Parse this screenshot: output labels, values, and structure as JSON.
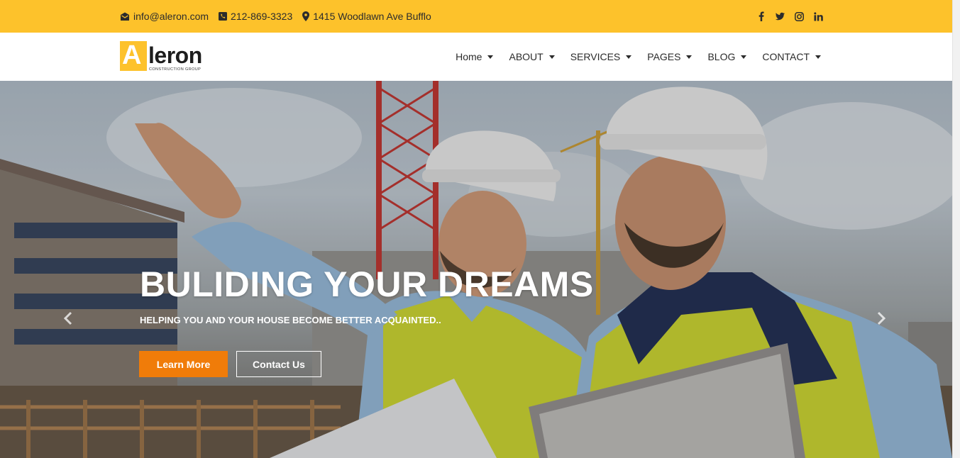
{
  "topbar": {
    "email": "info@aleron.com",
    "phone": "212-869-3323",
    "address": "1415 Woodlawn Ave Bufflo",
    "social": [
      "facebook-icon",
      "twitter-icon",
      "instagram-icon",
      "linkedin-icon"
    ],
    "background": "#fdc22b"
  },
  "logo": {
    "letter": "A",
    "name": "leron",
    "tagline": "CONSTRUCTION GROUP"
  },
  "nav": {
    "items": [
      {
        "label": "Home"
      },
      {
        "label": "ABOUT"
      },
      {
        "label": "SERVICES"
      },
      {
        "label": "PAGES"
      },
      {
        "label": "BLOG"
      },
      {
        "label": "CONTACT"
      }
    ]
  },
  "hero": {
    "title": "BULIDING YOUR DREAMS",
    "subtitle": "HELPING YOU AND YOUR HOUSE BECOME BETTER ACQUAINTED..",
    "primary_button": "Learn More",
    "secondary_button": "Contact Us",
    "accent_color": "#f07c09"
  }
}
